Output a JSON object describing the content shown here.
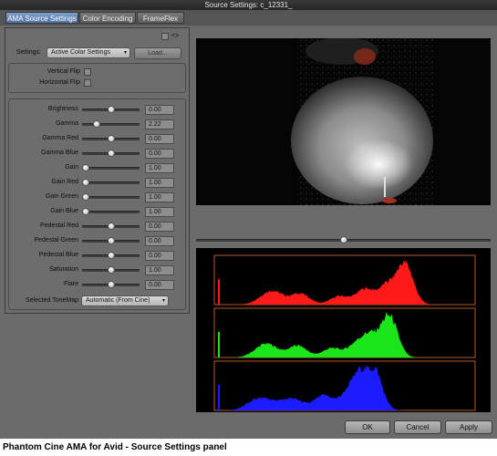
{
  "window": {
    "title": "Source Settings: c_12331_"
  },
  "tabs": [
    {
      "label": "AMA Source Settings",
      "active": true
    },
    {
      "label": "Color Encoding",
      "active": false
    },
    {
      "label": "FrameFlex",
      "active": false
    }
  ],
  "header": {
    "link_label": "<>"
  },
  "settings": {
    "label": "Settings:",
    "value": "Active Color Settings",
    "load_label": "Load..."
  },
  "flip": {
    "vertical_label": "Vertical Flip",
    "horizontal_label": "Horizontal Flip"
  },
  "sliders": [
    {
      "label": "Brightness",
      "value": "0.00",
      "level": 0.5
    },
    {
      "label": "Gamma",
      "value": "2.22",
      "level": 0.22
    },
    {
      "label": "Gamma Red",
      "value": "0.00",
      "level": 0.5
    },
    {
      "label": "Gamma Blue",
      "value": "0.00",
      "level": 0.5
    },
    {
      "label": "Gain",
      "value": "1.00",
      "level": 0.0
    },
    {
      "label": "Gain Red",
      "value": "1.00",
      "level": 0.0
    },
    {
      "label": "Gain Green",
      "value": "1.00",
      "level": 0.0
    },
    {
      "label": "Gain Blue",
      "value": "1.00",
      "level": 0.0
    },
    {
      "label": "Pedestal Red",
      "value": "0.00",
      "level": 0.5
    },
    {
      "label": "Pedestal Green",
      "value": "0.00",
      "level": 0.5
    },
    {
      "label": "Pedestal Blue",
      "value": "0.00",
      "level": 0.5
    },
    {
      "label": "Saturation",
      "value": "1.00",
      "level": 0.5
    },
    {
      "label": "Flare",
      "value": "0.00",
      "level": 0.5
    }
  ],
  "tonemap": {
    "label": "Selected ToneMap",
    "value": "Automatic (From Cine)"
  },
  "scrubber": {
    "level": 0.5
  },
  "histogram": {
    "channels": [
      {
        "name": "red",
        "color": "#ff1a1a"
      },
      {
        "name": "green",
        "color": "#19e619"
      },
      {
        "name": "blue",
        "color": "#1c1cff"
      }
    ],
    "marker_color": "#b35a2a"
  },
  "buttons": {
    "ok": "OK",
    "cancel": "Cancel",
    "apply": "Apply"
  },
  "caption": "Phantom Cine AMA for Avid - Source Settings panel"
}
